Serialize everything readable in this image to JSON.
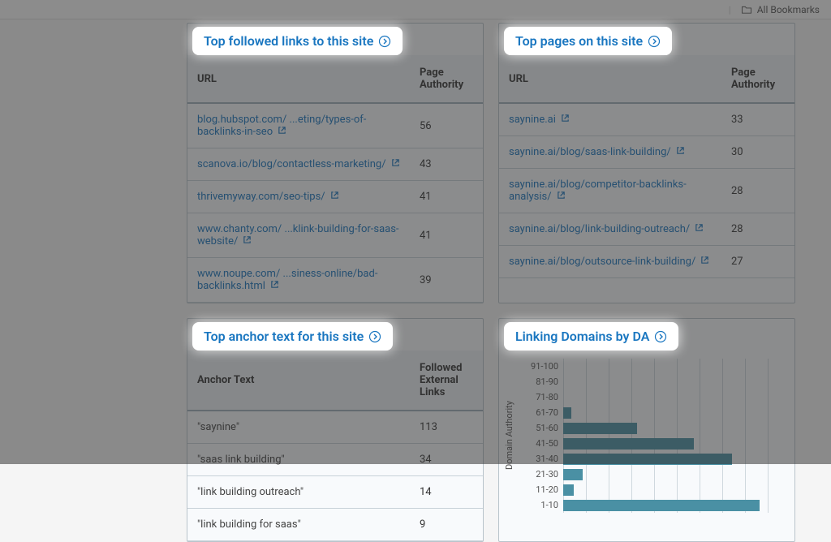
{
  "topbar": {
    "all_bookmarks": "All Bookmarks"
  },
  "cards": {
    "followed_links": {
      "title": "Top followed links to this site",
      "col_url": "URL",
      "col_pa": "Page Authority",
      "rows": [
        {
          "url": "blog.hubspot.com/ ...eting/types-of-backlinks-in-seo",
          "pa": "56"
        },
        {
          "url": "scanova.io/blog/contactless-marketing/",
          "pa": "43"
        },
        {
          "url": "thrivemyway.com/seo-tips/",
          "pa": "41"
        },
        {
          "url": "www.chanty.com/ ...klink-building-for-saas-website/",
          "pa": "41"
        },
        {
          "url": "www.noupe.com/ ...siness-online/bad-backlinks.html",
          "pa": "39"
        }
      ]
    },
    "top_pages": {
      "title": "Top pages on this site",
      "col_url": "URL",
      "col_pa": "Page Authority",
      "rows": [
        {
          "url": "saynine.ai",
          "pa": "33"
        },
        {
          "url": "saynine.ai/blog/saas-link-building/",
          "pa": "30"
        },
        {
          "url": "saynine.ai/blog/competitor-backlinks-analysis/",
          "pa": "28"
        },
        {
          "url": "saynine.ai/blog/link-building-outreach/",
          "pa": "28"
        },
        {
          "url": "saynine.ai/blog/outsource-link-building/",
          "pa": "27"
        }
      ]
    },
    "anchor_text": {
      "title": "Top anchor text for this site",
      "col_anchor": "Anchor Text",
      "col_links": "Followed External Links",
      "rows": [
        {
          "text": "\"saynine\"",
          "count": "113"
        },
        {
          "text": "\"saas link building\"",
          "count": "34"
        },
        {
          "text": "\"link building outreach\"",
          "count": "14"
        },
        {
          "text": "\"link building for saas\"",
          "count": "9"
        }
      ]
    },
    "linking_domains": {
      "title": "Linking Domains by DA",
      "yaxis": "Domain Authority"
    }
  },
  "chart_data": {
    "type": "bar",
    "orientation": "horizontal",
    "ylabel": "Domain Authority",
    "categories": [
      "91-100",
      "81-90",
      "71-80",
      "61-70",
      "51-60",
      "41-50",
      "31-40",
      "21-30",
      "11-20",
      "1-10"
    ],
    "values": [
      0,
      0,
      0,
      3,
      27,
      48,
      62,
      7,
      4,
      72
    ],
    "xlim": [
      0,
      80
    ]
  }
}
